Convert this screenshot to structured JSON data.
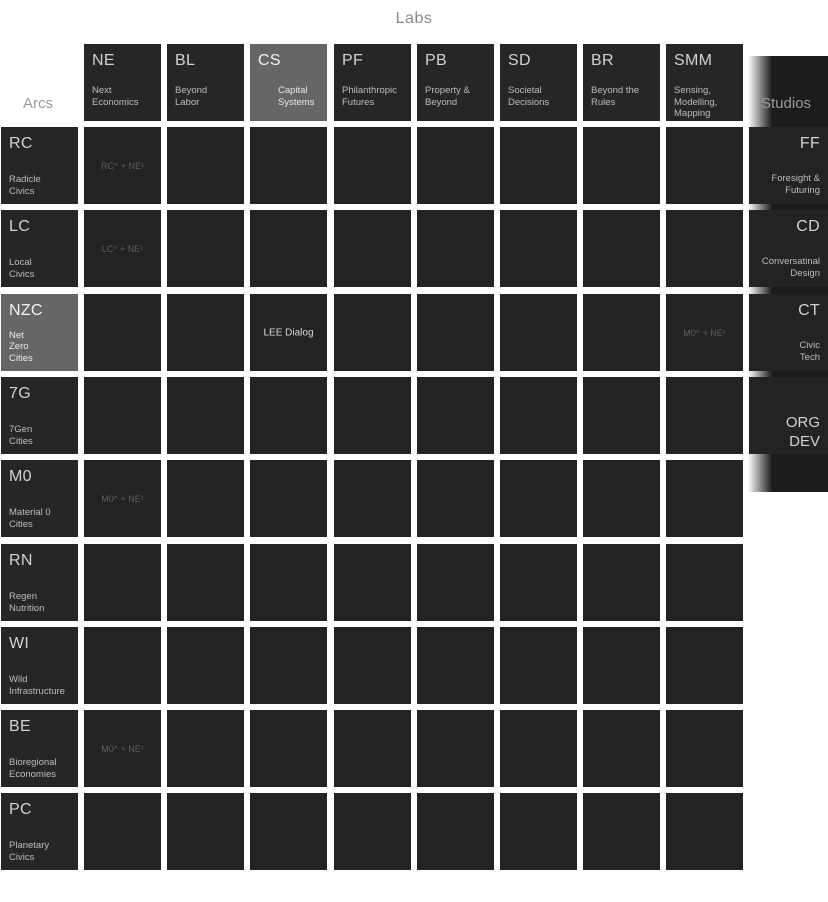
{
  "title": "Labs",
  "arcs_label": "Arcs",
  "studios_label": "Studios",
  "labs": [
    {
      "code": "NE",
      "name": "Next\nEconomics"
    },
    {
      "code": "BL",
      "name": "Beyond\nLabor"
    },
    {
      "code": "CS",
      "name": "Capital\nSystems",
      "highlight": true
    },
    {
      "code": "PF",
      "name": "Philanthropic\nFutures"
    },
    {
      "code": "PB",
      "name": "Property &\nBeyond"
    },
    {
      "code": "SD",
      "name": "Societal\nDecisions"
    },
    {
      "code": "BR",
      "name": "Beyond the\nRules"
    },
    {
      "code": "SMM",
      "name": "Sensing,\nModelling,\nMapping"
    }
  ],
  "arcs": [
    {
      "code": "RC",
      "name": "Radicle\nCivics"
    },
    {
      "code": "LC",
      "name": "Local\nCivics"
    },
    {
      "code": "NZC",
      "name": "Net\nZero\nCities",
      "highlight": true
    },
    {
      "code": "7G",
      "name": "7Gen\nCities"
    },
    {
      "code": "M0",
      "name": "Material 0\nCities"
    },
    {
      "code": "RN",
      "name": "Regen\nNutrition"
    },
    {
      "code": "WI",
      "name": "Wild\nInfrastructure"
    },
    {
      "code": "BE",
      "name": "Bioregional\nEconomies"
    },
    {
      "code": "PC",
      "name": "Planetary\nCivics"
    }
  ],
  "studios": [
    {
      "code": "FF",
      "name": "Foresight &\nFuturing"
    },
    {
      "code": "CD",
      "name": "Conversatinal\nDesign"
    },
    {
      "code": "CT",
      "name": "Civic\nTech"
    },
    {
      "code": "",
      "name": "ORG\nDEV",
      "big": true
    }
  ],
  "cells": [
    {
      "row": 0,
      "col": 0,
      "text": "RC^ + NE¹"
    },
    {
      "row": 1,
      "col": 0,
      "text": "LC^ + NE¹"
    },
    {
      "row": 2,
      "col": 2,
      "text": "LEE Dialog",
      "bright": true
    },
    {
      "row": 2,
      "col": 7,
      "text": "M0^ + NE¹"
    },
    {
      "row": 4,
      "col": 0,
      "text": "M0^ + NE¹"
    },
    {
      "row": 7,
      "col": 0,
      "text": "M0^ + NE¹"
    }
  ]
}
